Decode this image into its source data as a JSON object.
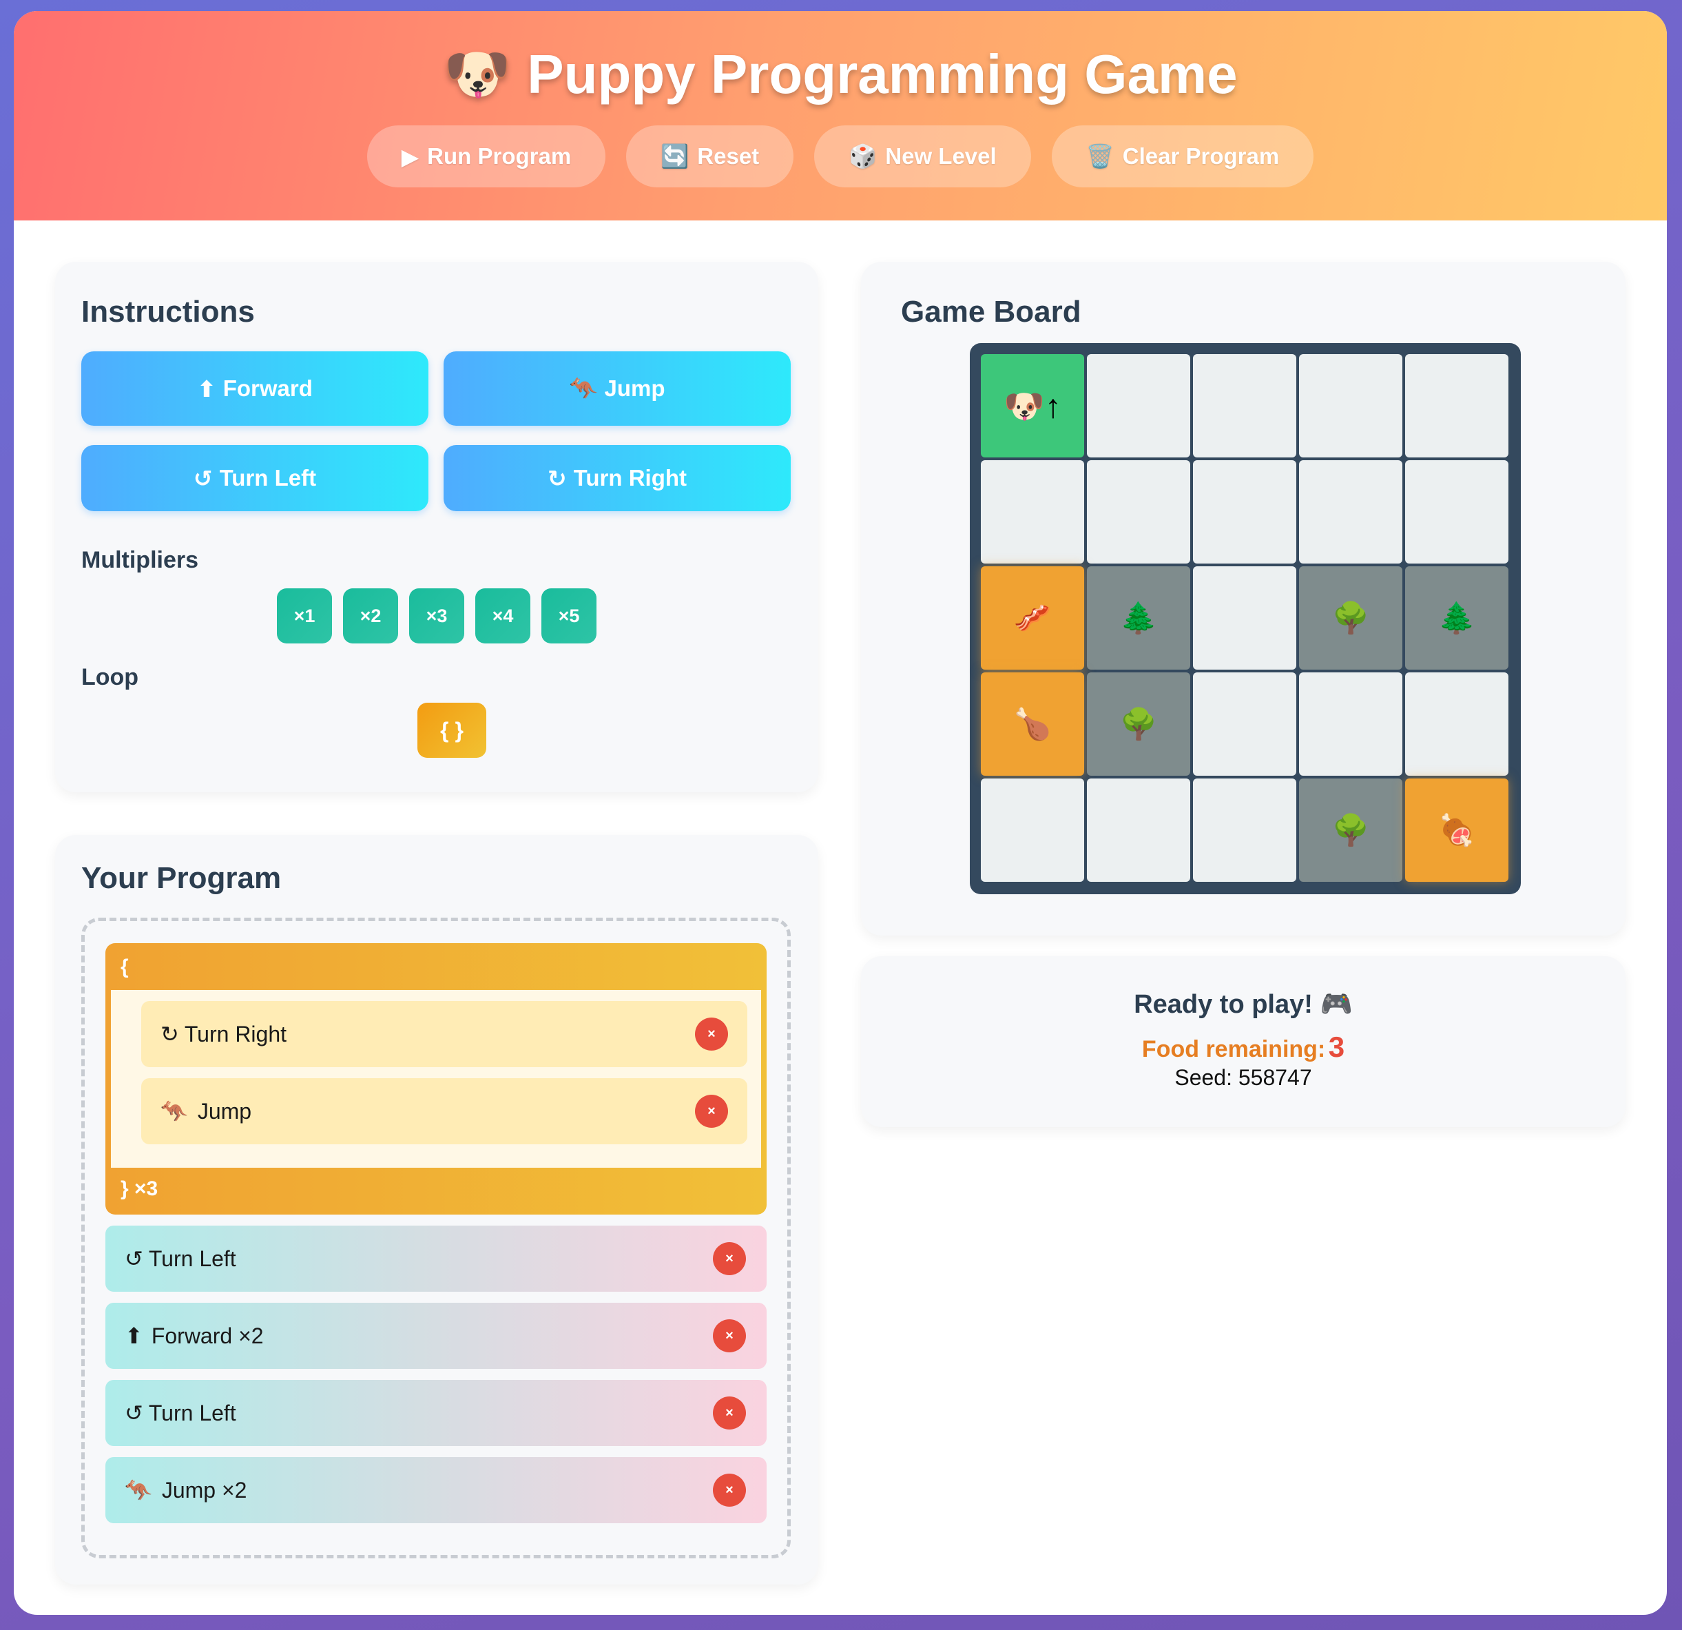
{
  "header": {
    "title_icon": "🐶",
    "title": "Puppy Programming Game",
    "buttons": [
      {
        "icon": "▶",
        "label": "Run Program"
      },
      {
        "icon": "🔄",
        "label": "Reset"
      },
      {
        "icon": "🎲",
        "label": "New Level"
      },
      {
        "icon": "🗑️",
        "label": "Clear Program"
      }
    ]
  },
  "instructions": {
    "heading": "Instructions",
    "buttons": [
      {
        "icon": "⬆",
        "label": "Forward"
      },
      {
        "icon": "🦘",
        "label": "Jump"
      },
      {
        "icon": "↺",
        "label": "Turn Left"
      },
      {
        "icon": "↻",
        "label": "Turn Right"
      }
    ],
    "multipliers_heading": "Multipliers",
    "multipliers": [
      "×1",
      "×2",
      "×3",
      "×4",
      "×5"
    ],
    "loop_heading": "Loop",
    "loop_button": "{ }"
  },
  "program": {
    "heading": "Your Program",
    "loop": {
      "open": "{",
      "close": "} ×3",
      "items": [
        {
          "icon": "↻",
          "label": "Turn Right"
        },
        {
          "icon": "🦘",
          "label": "Jump"
        }
      ]
    },
    "items": [
      {
        "icon": "↺",
        "label": "Turn Left"
      },
      {
        "icon": "⬆",
        "label": "Forward ×2"
      },
      {
        "icon": "↺",
        "label": "Turn Left"
      },
      {
        "icon": "🦘",
        "label": "Jump ×2"
      }
    ],
    "delete_glyph": "×"
  },
  "board": {
    "heading": "Game Board",
    "rows": [
      [
        {
          "type": "puppy",
          "content": "🐶↑"
        },
        {
          "type": "empty",
          "content": ""
        },
        {
          "type": "empty",
          "content": ""
        },
        {
          "type": "empty",
          "content": ""
        },
        {
          "type": "empty",
          "content": ""
        }
      ],
      [
        {
          "type": "empty",
          "content": ""
        },
        {
          "type": "empty",
          "content": ""
        },
        {
          "type": "empty",
          "content": ""
        },
        {
          "type": "empty",
          "content": ""
        },
        {
          "type": "empty",
          "content": ""
        }
      ],
      [
        {
          "type": "food",
          "content": "🥓"
        },
        {
          "type": "tree",
          "content": "🌲"
        },
        {
          "type": "empty",
          "content": ""
        },
        {
          "type": "tree",
          "content": "🌳"
        },
        {
          "type": "tree",
          "content": "🌲"
        }
      ],
      [
        {
          "type": "food",
          "content": "🍗"
        },
        {
          "type": "tree",
          "content": "🌳"
        },
        {
          "type": "empty",
          "content": ""
        },
        {
          "type": "empty",
          "content": ""
        },
        {
          "type": "empty",
          "content": ""
        }
      ],
      [
        {
          "type": "empty",
          "content": ""
        },
        {
          "type": "empty",
          "content": ""
        },
        {
          "type": "empty",
          "content": ""
        },
        {
          "type": "tree",
          "content": "🌳"
        },
        {
          "type": "food",
          "content": "🍖"
        }
      ]
    ]
  },
  "status": {
    "message": "Ready to play! 🎮",
    "food_label": "Food remaining:",
    "food_count": "3",
    "seed_label": "Seed: 558747"
  }
}
